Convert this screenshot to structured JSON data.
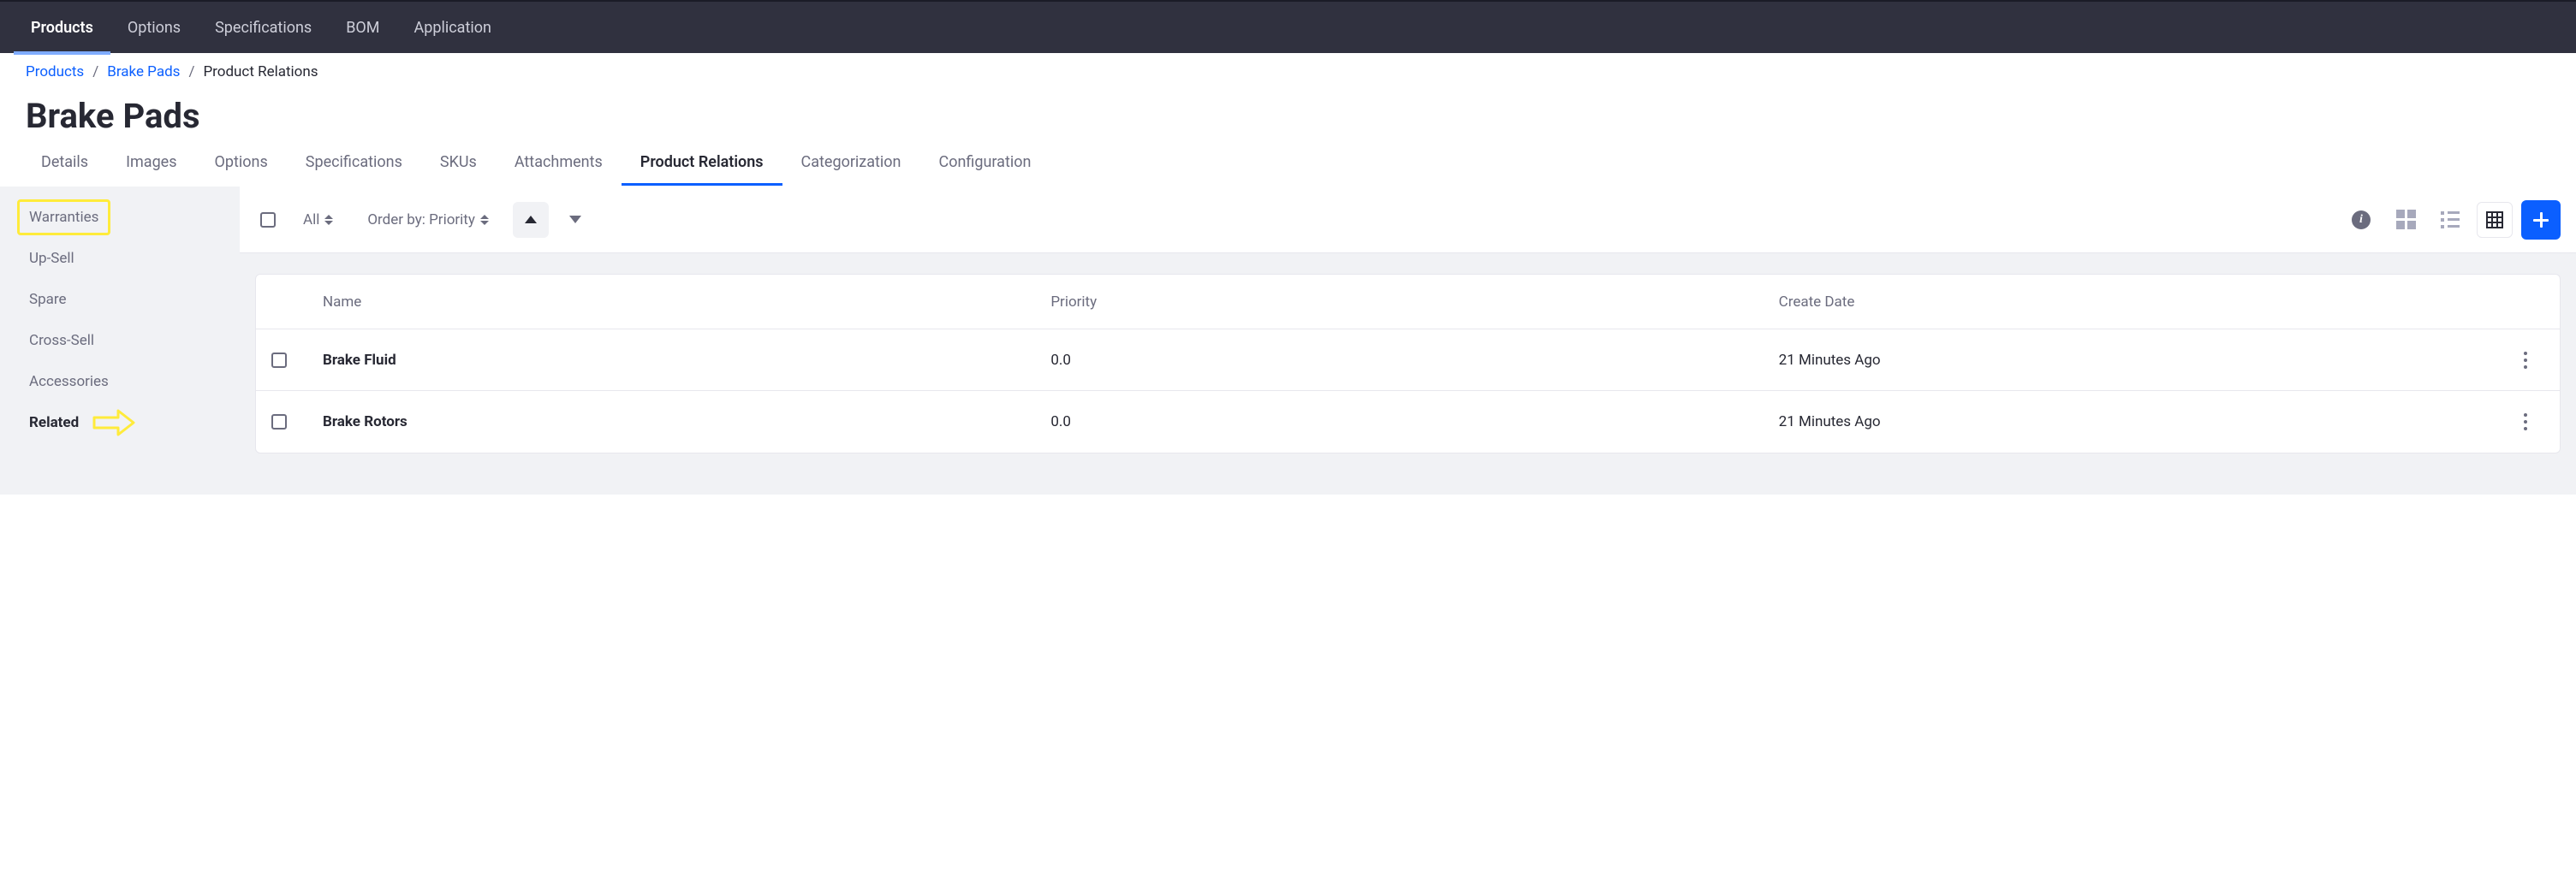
{
  "topnav": {
    "items": [
      {
        "label": "Products",
        "active": true
      },
      {
        "label": "Options"
      },
      {
        "label": "Specifications"
      },
      {
        "label": "BOM"
      },
      {
        "label": "Application"
      }
    ]
  },
  "breadcrumb": {
    "items": [
      {
        "label": "Products",
        "link": true
      },
      {
        "label": "Brake Pads",
        "link": true
      },
      {
        "label": "Product Relations",
        "link": false
      }
    ]
  },
  "page_title": "Brake Pads",
  "subtabs": {
    "items": [
      {
        "label": "Details"
      },
      {
        "label": "Images"
      },
      {
        "label": "Options"
      },
      {
        "label": "Specifications"
      },
      {
        "label": "SKUs"
      },
      {
        "label": "Attachments"
      },
      {
        "label": "Product Relations",
        "active": true
      },
      {
        "label": "Categorization"
      },
      {
        "label": "Configuration"
      }
    ]
  },
  "sidebar": {
    "items": [
      {
        "label": "Warranties",
        "highlight": true
      },
      {
        "label": "Up-Sell"
      },
      {
        "label": "Spare"
      },
      {
        "label": "Cross-Sell"
      },
      {
        "label": "Accessories"
      },
      {
        "label": "Related",
        "active": true,
        "arrow": true
      }
    ]
  },
  "toolbar": {
    "filter_label": "All",
    "orderby_prefix": "Order by: ",
    "orderby_value": "Priority"
  },
  "table": {
    "columns": [
      "Name",
      "Priority",
      "Create Date"
    ],
    "rows": [
      {
        "name": "Brake Fluid",
        "priority": "0.0",
        "create_date": "21 Minutes Ago"
      },
      {
        "name": "Brake Rotors",
        "priority": "0.0",
        "create_date": "21 Minutes Ago"
      }
    ]
  }
}
